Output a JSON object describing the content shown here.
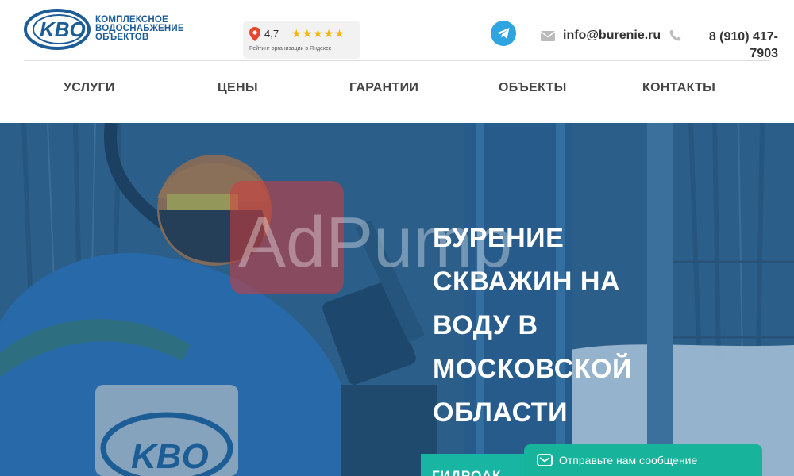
{
  "logo": {
    "mark": "KBO",
    "line1": "КОМПЛЕКСНОЕ",
    "line2": "ВОДОСНАБЖЕНИЕ",
    "line3": "ОБЪЕКТОВ"
  },
  "rating": {
    "score": "4,7",
    "stars": 4.7,
    "caption": "Рейтинг организации в Яндексе",
    "pin_icon": "map-pin-icon",
    "star_color": "#f7b500"
  },
  "contacts": {
    "telegram_icon": "telegram-icon",
    "email": "info@burenie.ru",
    "phone_line1": "8 (910) 417-",
    "phone_line2": "7903"
  },
  "nav": {
    "items": [
      "УСЛУГИ",
      "ЦЕНЫ",
      "ГАРАНТИИ",
      "ОБЪЕКТЫ",
      "КОНТАКТЫ"
    ]
  },
  "hero": {
    "title_lines": [
      "БУРЕНИЕ",
      "СКВАЖИН НА",
      "ВОДУ В",
      "МОСКОВСКОЙ",
      "ОБЛАСТИ"
    ],
    "cta_label": "ГИДРОАК",
    "jacket_logo": "KBO",
    "watermark": "AdPump"
  },
  "chat": {
    "label": "Отправьте нам сообщение",
    "icon": "message-icon"
  },
  "colors": {
    "brand_blue": "#1c5c97",
    "telegram": "#2ea5e0",
    "teal": "#17b5a2",
    "hero_overlay": "#2c5e86"
  }
}
